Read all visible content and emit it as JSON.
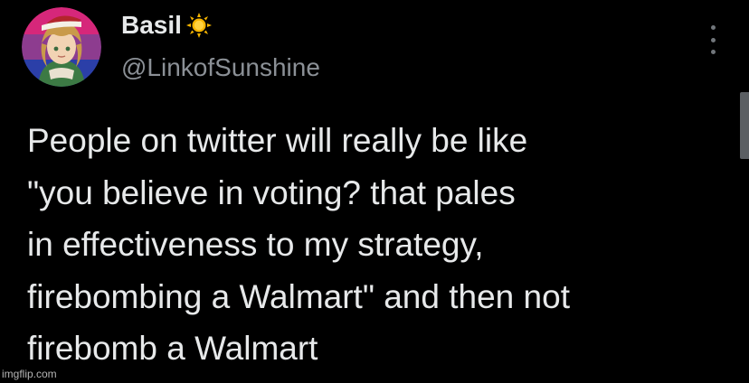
{
  "user": {
    "display_name": "Basil",
    "handle": "@LinkofSunshine",
    "name_emoji": "sun-icon",
    "avatar": "avatar"
  },
  "post": {
    "lines": [
      "People on twitter will really be like",
      "\"you believe in voting? that pales",
      "in effectiveness to my strategy,",
      "firebombing a Walmart\" and then not",
      "firebomb a Walmart"
    ]
  },
  "watermark": "imgflip.com",
  "colors": {
    "background": "#000000",
    "text": "#e7e9ea",
    "secondary_text": "#8b9096",
    "sun": "#f5b400"
  }
}
